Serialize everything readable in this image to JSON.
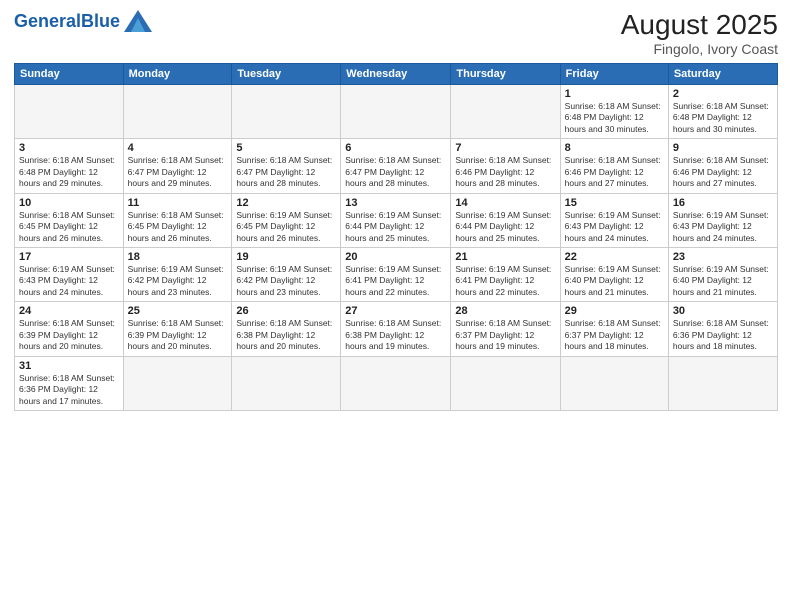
{
  "header": {
    "logo_general": "General",
    "logo_blue": "Blue",
    "title": "August 2025",
    "subtitle": "Fingolo, Ivory Coast"
  },
  "weekdays": [
    "Sunday",
    "Monday",
    "Tuesday",
    "Wednesday",
    "Thursday",
    "Friday",
    "Saturday"
  ],
  "weeks": [
    [
      {
        "day": "",
        "info": ""
      },
      {
        "day": "",
        "info": ""
      },
      {
        "day": "",
        "info": ""
      },
      {
        "day": "",
        "info": ""
      },
      {
        "day": "",
        "info": ""
      },
      {
        "day": "1",
        "info": "Sunrise: 6:18 AM\nSunset: 6:48 PM\nDaylight: 12 hours and 30 minutes."
      },
      {
        "day": "2",
        "info": "Sunrise: 6:18 AM\nSunset: 6:48 PM\nDaylight: 12 hours and 30 minutes."
      }
    ],
    [
      {
        "day": "3",
        "info": "Sunrise: 6:18 AM\nSunset: 6:48 PM\nDaylight: 12 hours and 29 minutes."
      },
      {
        "day": "4",
        "info": "Sunrise: 6:18 AM\nSunset: 6:47 PM\nDaylight: 12 hours and 29 minutes."
      },
      {
        "day": "5",
        "info": "Sunrise: 6:18 AM\nSunset: 6:47 PM\nDaylight: 12 hours and 28 minutes."
      },
      {
        "day": "6",
        "info": "Sunrise: 6:18 AM\nSunset: 6:47 PM\nDaylight: 12 hours and 28 minutes."
      },
      {
        "day": "7",
        "info": "Sunrise: 6:18 AM\nSunset: 6:46 PM\nDaylight: 12 hours and 28 minutes."
      },
      {
        "day": "8",
        "info": "Sunrise: 6:18 AM\nSunset: 6:46 PM\nDaylight: 12 hours and 27 minutes."
      },
      {
        "day": "9",
        "info": "Sunrise: 6:18 AM\nSunset: 6:46 PM\nDaylight: 12 hours and 27 minutes."
      }
    ],
    [
      {
        "day": "10",
        "info": "Sunrise: 6:18 AM\nSunset: 6:45 PM\nDaylight: 12 hours and 26 minutes."
      },
      {
        "day": "11",
        "info": "Sunrise: 6:18 AM\nSunset: 6:45 PM\nDaylight: 12 hours and 26 minutes."
      },
      {
        "day": "12",
        "info": "Sunrise: 6:19 AM\nSunset: 6:45 PM\nDaylight: 12 hours and 26 minutes."
      },
      {
        "day": "13",
        "info": "Sunrise: 6:19 AM\nSunset: 6:44 PM\nDaylight: 12 hours and 25 minutes."
      },
      {
        "day": "14",
        "info": "Sunrise: 6:19 AM\nSunset: 6:44 PM\nDaylight: 12 hours and 25 minutes."
      },
      {
        "day": "15",
        "info": "Sunrise: 6:19 AM\nSunset: 6:43 PM\nDaylight: 12 hours and 24 minutes."
      },
      {
        "day": "16",
        "info": "Sunrise: 6:19 AM\nSunset: 6:43 PM\nDaylight: 12 hours and 24 minutes."
      }
    ],
    [
      {
        "day": "17",
        "info": "Sunrise: 6:19 AM\nSunset: 6:43 PM\nDaylight: 12 hours and 24 minutes."
      },
      {
        "day": "18",
        "info": "Sunrise: 6:19 AM\nSunset: 6:42 PM\nDaylight: 12 hours and 23 minutes."
      },
      {
        "day": "19",
        "info": "Sunrise: 6:19 AM\nSunset: 6:42 PM\nDaylight: 12 hours and 23 minutes."
      },
      {
        "day": "20",
        "info": "Sunrise: 6:19 AM\nSunset: 6:41 PM\nDaylight: 12 hours and 22 minutes."
      },
      {
        "day": "21",
        "info": "Sunrise: 6:19 AM\nSunset: 6:41 PM\nDaylight: 12 hours and 22 minutes."
      },
      {
        "day": "22",
        "info": "Sunrise: 6:19 AM\nSunset: 6:40 PM\nDaylight: 12 hours and 21 minutes."
      },
      {
        "day": "23",
        "info": "Sunrise: 6:19 AM\nSunset: 6:40 PM\nDaylight: 12 hours and 21 minutes."
      }
    ],
    [
      {
        "day": "24",
        "info": "Sunrise: 6:18 AM\nSunset: 6:39 PM\nDaylight: 12 hours and 20 minutes."
      },
      {
        "day": "25",
        "info": "Sunrise: 6:18 AM\nSunset: 6:39 PM\nDaylight: 12 hours and 20 minutes."
      },
      {
        "day": "26",
        "info": "Sunrise: 6:18 AM\nSunset: 6:38 PM\nDaylight: 12 hours and 20 minutes."
      },
      {
        "day": "27",
        "info": "Sunrise: 6:18 AM\nSunset: 6:38 PM\nDaylight: 12 hours and 19 minutes."
      },
      {
        "day": "28",
        "info": "Sunrise: 6:18 AM\nSunset: 6:37 PM\nDaylight: 12 hours and 19 minutes."
      },
      {
        "day": "29",
        "info": "Sunrise: 6:18 AM\nSunset: 6:37 PM\nDaylight: 12 hours and 18 minutes."
      },
      {
        "day": "30",
        "info": "Sunrise: 6:18 AM\nSunset: 6:36 PM\nDaylight: 12 hours and 18 minutes."
      }
    ],
    [
      {
        "day": "31",
        "info": "Sunrise: 6:18 AM\nSunset: 6:36 PM\nDaylight: 12 hours and 17 minutes."
      },
      {
        "day": "",
        "info": ""
      },
      {
        "day": "",
        "info": ""
      },
      {
        "day": "",
        "info": ""
      },
      {
        "day": "",
        "info": ""
      },
      {
        "day": "",
        "info": ""
      },
      {
        "day": "",
        "info": ""
      }
    ]
  ]
}
